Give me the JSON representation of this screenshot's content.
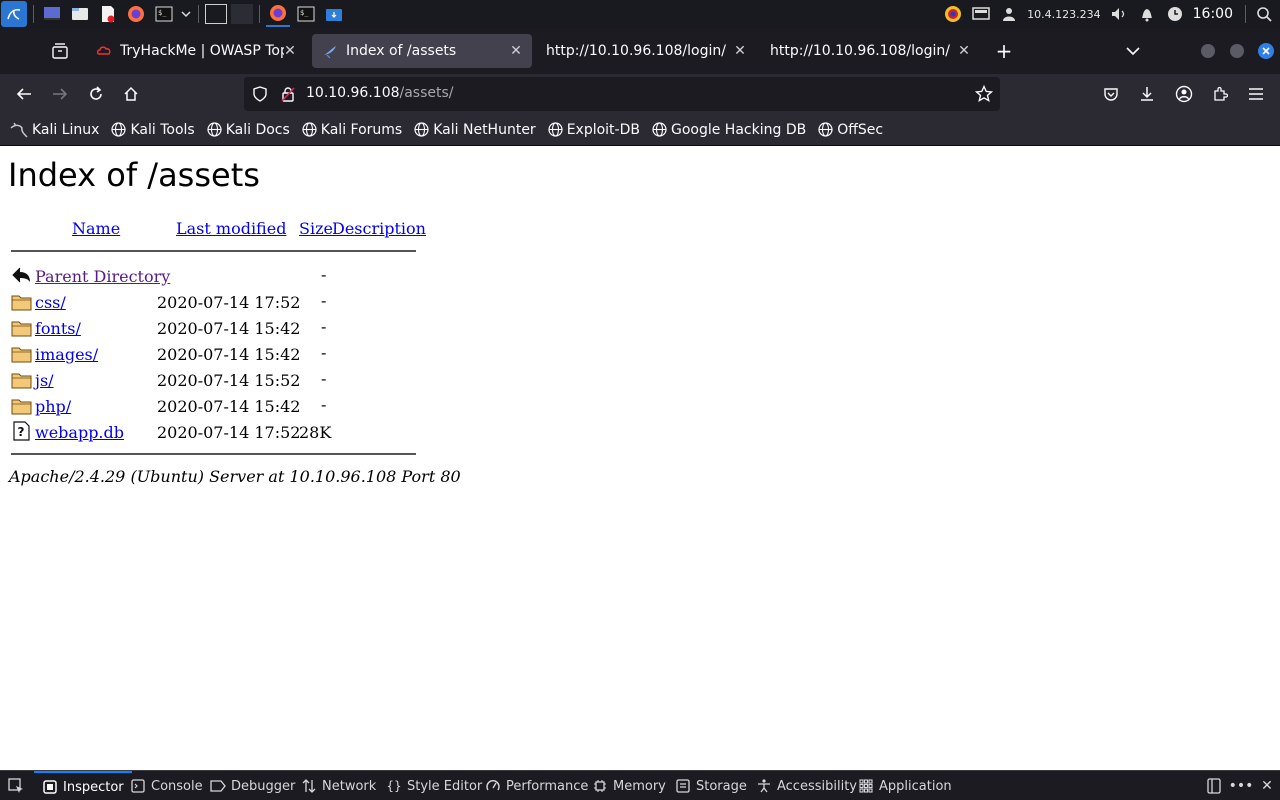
{
  "os_panel": {
    "tray_ip": "10.4.123.234",
    "clock": "16:00"
  },
  "tabs": [
    {
      "title": "TryHackMe | OWASP Top",
      "active": false
    },
    {
      "title": "Index of /assets",
      "active": true
    },
    {
      "title": "http://10.10.96.108/login/",
      "active": false
    },
    {
      "title": "http://10.10.96.108/login/",
      "active": false
    }
  ],
  "urlbar": {
    "host": "10.10.96.108",
    "path": "/assets/"
  },
  "bookmarks": [
    "Kali Linux",
    "Kali Tools",
    "Kali Docs",
    "Kali Forums",
    "Kali NetHunter",
    "Exploit-DB",
    "Google Hacking DB",
    "OffSec"
  ],
  "page": {
    "heading": "Index of /assets",
    "columns": {
      "name": "Name",
      "modified": "Last modified",
      "size": "Size",
      "description": "Description"
    },
    "rows": [
      {
        "name": "Parent Directory",
        "modified": "",
        "size": "-",
        "icon": "back-icon"
      },
      {
        "name": "css/",
        "modified": "2020-07-14 17:52",
        "size": "-",
        "icon": "folder-icon"
      },
      {
        "name": "fonts/",
        "modified": "2020-07-14 15:42",
        "size": "-",
        "icon": "folder-icon"
      },
      {
        "name": "images/",
        "modified": "2020-07-14 15:42",
        "size": "-",
        "icon": "folder-icon"
      },
      {
        "name": "js/",
        "modified": "2020-07-14 15:52",
        "size": "-",
        "icon": "folder-icon"
      },
      {
        "name": "php/",
        "modified": "2020-07-14 15:42",
        "size": "-",
        "icon": "folder-icon"
      },
      {
        "name": "webapp.db",
        "modified": "2020-07-14 17:52",
        "size": "28K",
        "icon": "unknown-file-icon"
      }
    ],
    "address": "Apache/2.4.29 (Ubuntu) Server at 10.10.96.108 Port 80"
  },
  "devtools": {
    "tabs": [
      "Inspector",
      "Console",
      "Debugger",
      "Network",
      "Style Editor",
      "Performance",
      "Memory",
      "Storage",
      "Accessibility",
      "Application"
    ],
    "active": "Inspector"
  },
  "colors": {
    "link": "#0000ee",
    "visited": "#551a8b",
    "accent": "#0a84ff"
  }
}
